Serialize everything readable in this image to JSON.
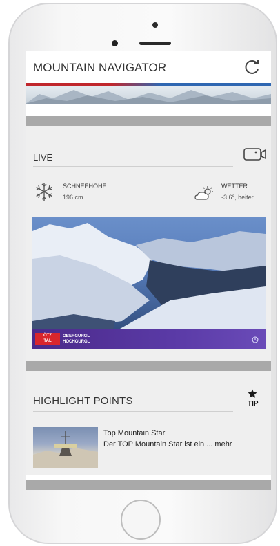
{
  "header": {
    "title": "MOUNTAIN NAVIGATOR",
    "refresh_icon": "refresh-icon"
  },
  "live": {
    "label": "LIVE",
    "video_icon": "video-camera-icon",
    "snow": {
      "icon": "snowflake-icon",
      "label": "SCHNEEHÖHE",
      "value": "196 cm"
    },
    "weather": {
      "icon": "partly-sunny-icon",
      "label": "WETTER",
      "value": "-3.6°, heiter"
    },
    "webcam": {
      "logo_line1": "ÖTZ",
      "logo_line2": "TAL",
      "resort_line1": "OBERGURGL",
      "resort_line2": "HOCHGURGL"
    }
  },
  "highlights": {
    "title": "HIGHLIGHT POINTS",
    "tip_icon": "star-icon",
    "tip_label": "TIP",
    "item": {
      "name": "Top Mountain Star",
      "description": "Der TOP Mountain Star ist ein ... mehr"
    }
  },
  "colors": {
    "accent_red": "#c0272d",
    "accent_blue": "#2f67b2",
    "separator": "#a9a9a9",
    "section_bg": "#efefef"
  }
}
